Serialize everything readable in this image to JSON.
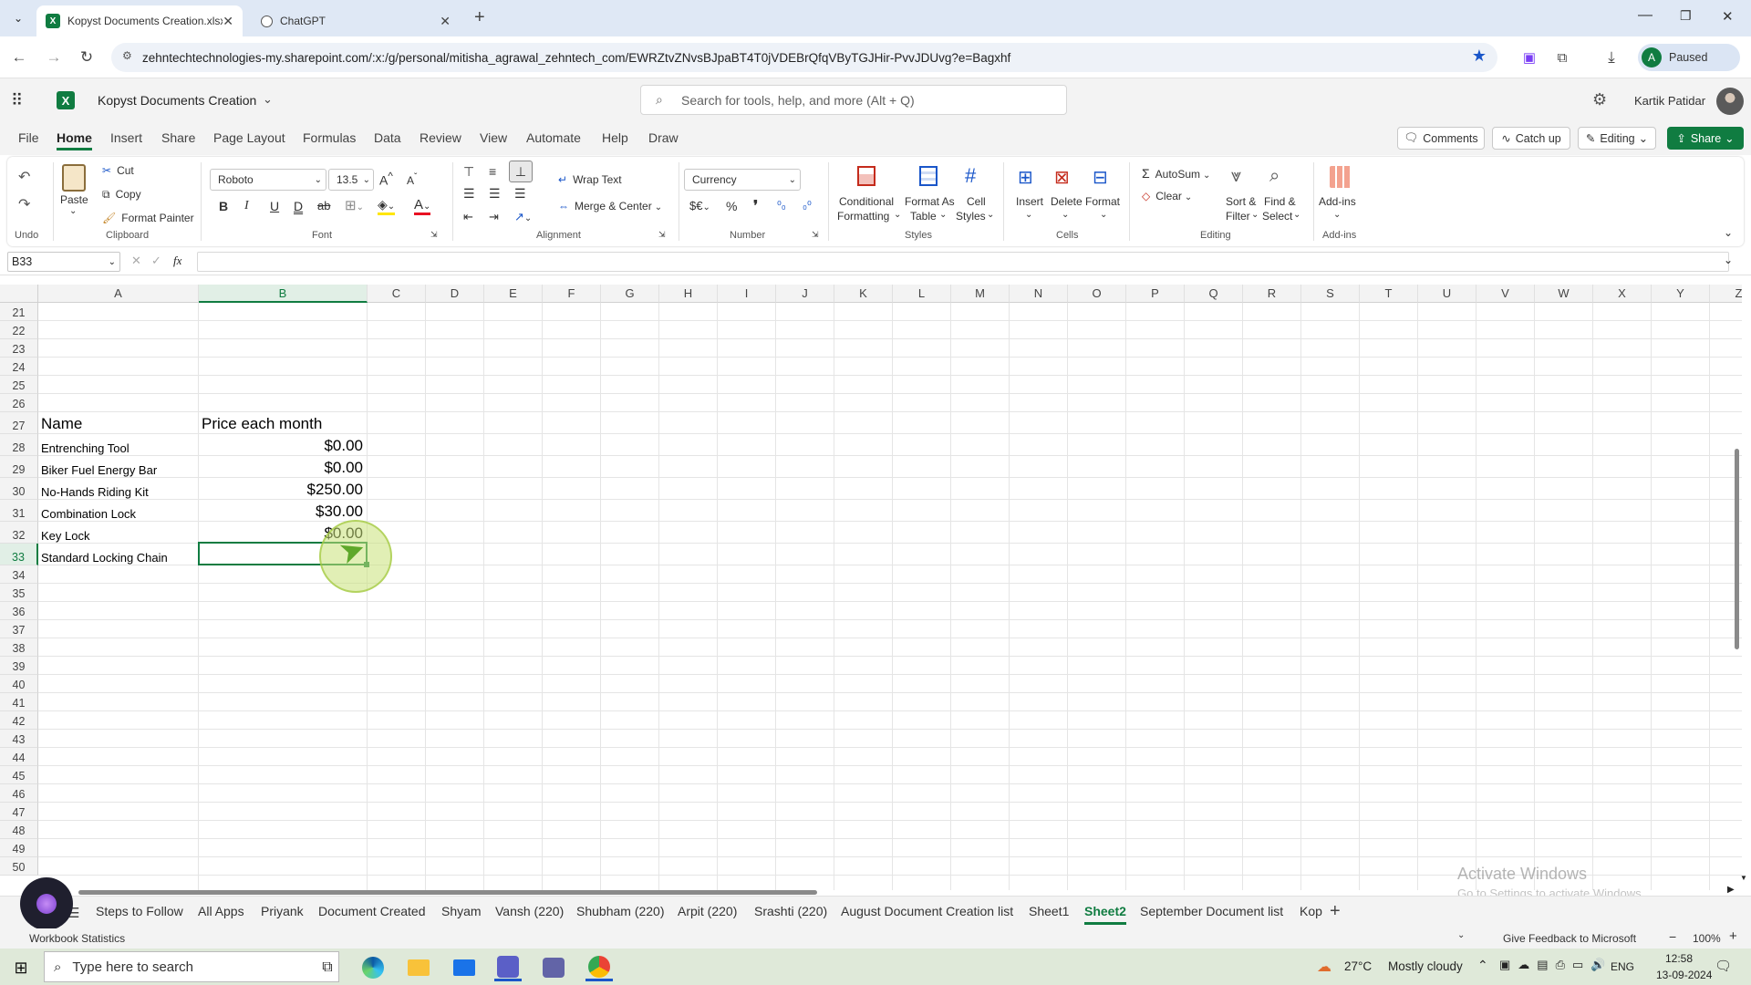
{
  "browser": {
    "tabs": [
      {
        "title": "Kopyst Documents Creation.xlsx",
        "active": true
      },
      {
        "title": "ChatGPT",
        "active": false
      }
    ],
    "url": "zehntechtechnologies-my.sharepoint.com/:x:/g/personal/mitisha_agrawal_zehntech_com/EWRZtvZNvsBJpaBT4T0jVDEBrQfqVByTGJHir-PvvJDUvg?e=Bagxhf",
    "profile_initial": "A",
    "profile_status": "Paused"
  },
  "app": {
    "file_name": "Kopyst Documents Creation",
    "search_placeholder": "Search for tools, help, and more (Alt + Q)",
    "user_name": "Kartik Patidar"
  },
  "menu": {
    "items": [
      "File",
      "Home",
      "Insert",
      "Share",
      "Page Layout",
      "Formulas",
      "Data",
      "Review",
      "View",
      "Automate",
      "Help",
      "Draw"
    ],
    "active": "Home",
    "comments": "Comments",
    "catch_up": "Catch up",
    "editing": "Editing",
    "share": "Share"
  },
  "ribbon": {
    "undo_group": "Undo",
    "paste": "Paste",
    "cut": "Cut",
    "copy": "Copy",
    "format_painter": "Format Painter",
    "clipboard_group": "Clipboard",
    "font_name": "Roboto",
    "font_size": "13.5",
    "bold": "B",
    "italic": "I",
    "underline": "U",
    "double_underline": "D",
    "strikethrough": "ab",
    "font_group": "Font",
    "wrap_text": "Wrap Text",
    "merge_center": "Merge & Center",
    "alignment_group": "Alignment",
    "number_format": "Currency",
    "number_group": "Number",
    "conditional_formatting": [
      "Conditional",
      "Formatting"
    ],
    "format_as_table": [
      "Format As",
      "Table"
    ],
    "cell_styles": [
      "Cell",
      "Styles"
    ],
    "styles_group": "Styles",
    "insert": "Insert",
    "delete": "Delete",
    "format": "Format",
    "cells_group": "Cells",
    "autosum": "AutoSum",
    "clear": "Clear",
    "sort_filter": [
      "Sort &",
      "Filter"
    ],
    "find_select": [
      "Find &",
      "Select"
    ],
    "editing_group": "Editing",
    "addins": "Add-ins",
    "addins_group": "Add-ins"
  },
  "formula_bar": {
    "name_box": "B33",
    "formula": ""
  },
  "grid": {
    "columns": [
      "A",
      "B",
      "C",
      "D",
      "E",
      "F",
      "G",
      "H",
      "I",
      "J",
      "K",
      "L",
      "M",
      "N",
      "O",
      "P",
      "Q",
      "R",
      "S",
      "T",
      "U",
      "V",
      "W",
      "X",
      "Y",
      "Z"
    ],
    "selected_column": "B",
    "first_row": 21,
    "last_row": 50,
    "selected_row": 33,
    "header": {
      "row": 27,
      "a": "Name",
      "b": "Price each month"
    },
    "rows": [
      {
        "row": 28,
        "name": "Entrenching Tool",
        "price": "$0.00"
      },
      {
        "row": 29,
        "name": "Biker Fuel Energy Bar",
        "price": "$0.00"
      },
      {
        "row": 30,
        "name": "No-Hands Riding Kit",
        "price": "$250.00"
      },
      {
        "row": 31,
        "name": "Combination Lock",
        "price": "$30.00"
      },
      {
        "row": 32,
        "name": "Key Lock",
        "price": "$0.00"
      },
      {
        "row": 33,
        "name": "Standard Locking Chain",
        "price": ""
      }
    ]
  },
  "watermark": {
    "title": "Activate Windows",
    "subtitle": "Go to Settings to activate Windows."
  },
  "sheets": {
    "tabs": [
      "Steps to Follow",
      "All Apps",
      "Priyank",
      "Document Created",
      "Shyam",
      "Vansh (220)",
      "Shubham (220)",
      "Arpit (220)",
      "Srashti (220)",
      "August Document Creation list",
      "Sheet1",
      "Sheet2",
      "September Document list",
      "Kop"
    ],
    "active": "Sheet2"
  },
  "status": {
    "workbook_statistics": "Workbook Statistics",
    "feedback": "Give Feedback to Microsoft",
    "zoom": "100%"
  },
  "taskbar": {
    "search_placeholder": "Type here to search",
    "temperature": "27°C",
    "weather": "Mostly cloudy",
    "language": "ENG",
    "time": "12:58",
    "date": "13-09-2024"
  },
  "colors": {
    "excel_green": "#107c41",
    "chrome_tab_bar": "#dfe8f5",
    "taskbar": "#dfe9d9"
  }
}
